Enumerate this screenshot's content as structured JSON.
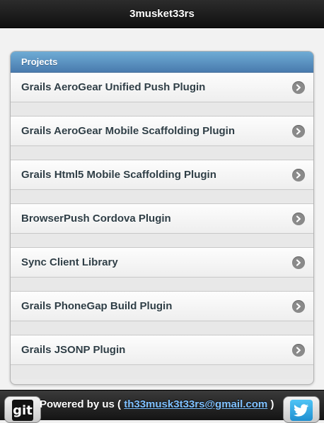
{
  "header": {
    "title": "3musket33rs"
  },
  "projects": {
    "heading": "Projects",
    "items": [
      {
        "label": "Grails AeroGear Unified Push Plugin"
      },
      {
        "label": "Grails AeroGear Mobile Scaffolding Plugin"
      },
      {
        "label": "Grails Html5 Mobile Scaffolding Plugin"
      },
      {
        "label": "BrowserPush Cordova Plugin"
      },
      {
        "label": "Sync Client Library"
      },
      {
        "label": "Grails PhoneGap Build Plugin"
      },
      {
        "label": "Grails JSONP Plugin"
      }
    ],
    "item_icon": "chevron-right-circle-icon"
  },
  "footer": {
    "prefix": "Powered by us ( ",
    "email": "th33musk3t33rs@gmail.com",
    "suffix": " )",
    "git_label": "git",
    "git_icon": "git-icon",
    "twitter_icon": "twitter-icon"
  },
  "colors": {
    "header_bg": "#1a1a1a",
    "list_header_bg": "#5a92c4",
    "link": "#7ec0ff"
  }
}
